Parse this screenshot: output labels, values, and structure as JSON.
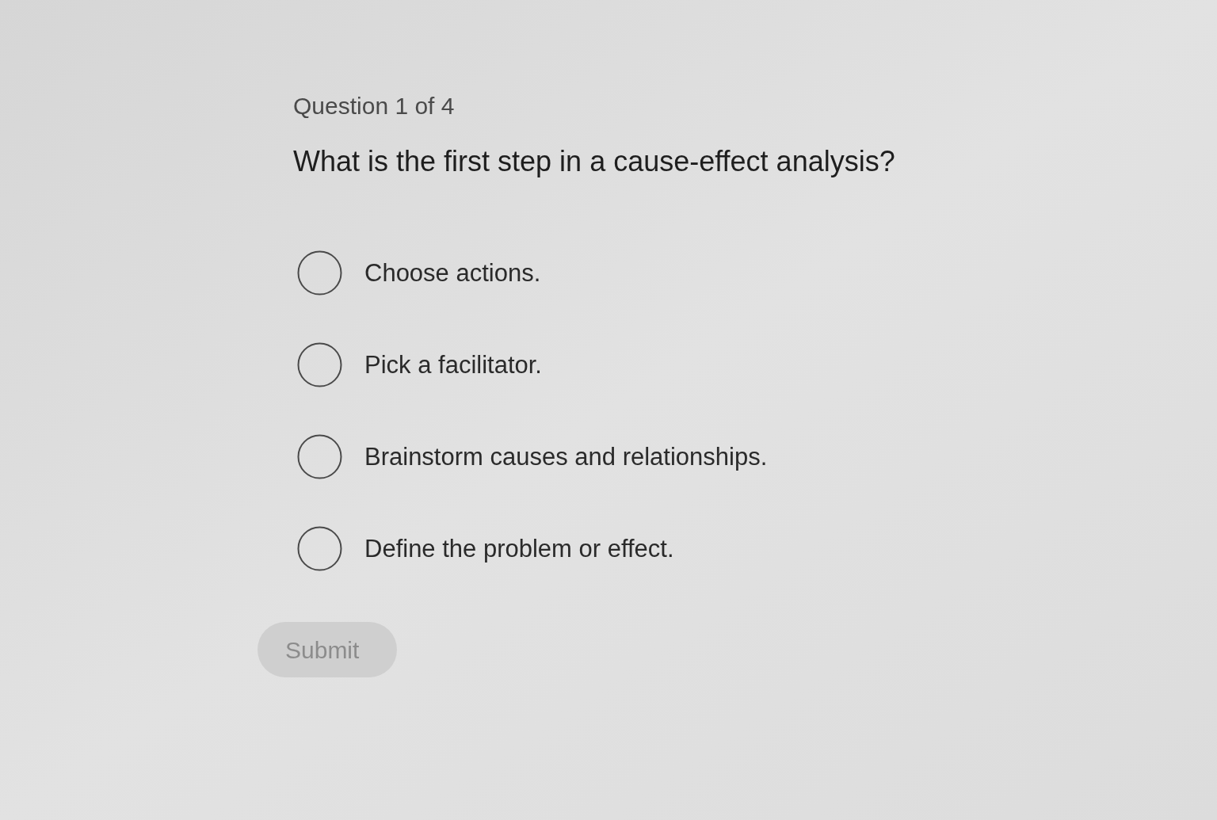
{
  "progress": "Question 1 of 4",
  "question": "What is the first step in a cause-effect analysis?",
  "options": [
    {
      "label": "Choose actions.",
      "selected": false
    },
    {
      "label": "Pick a facilitator.",
      "selected": false
    },
    {
      "label": "Brainstorm causes and relationships.",
      "selected": false
    },
    {
      "label": "Define the problem or effect.",
      "selected": false
    }
  ],
  "submit": {
    "label": "Submit",
    "disabled": true
  }
}
